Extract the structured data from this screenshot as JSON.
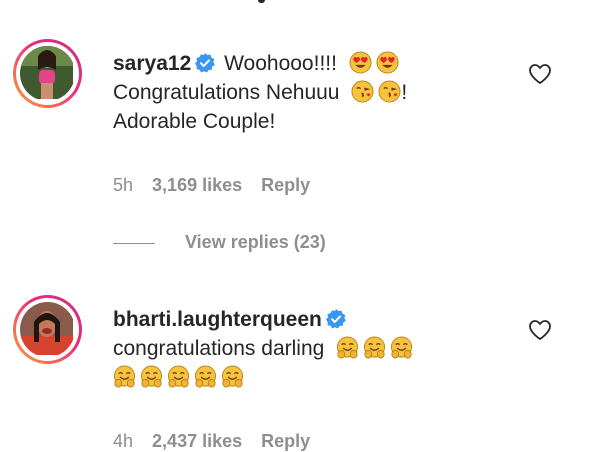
{
  "comments": [
    {
      "username": "sarya12",
      "verified": true,
      "text_line1": "Woohooo!!!!",
      "emojis_line1": [
        "heart-eyes",
        "heart-eyes"
      ],
      "text_line2": "Congratulations Nehuuu",
      "emojis_line2": [
        "kiss-face",
        "kiss-face"
      ],
      "text_line2_suffix": "!",
      "text_line3": "Adorable Couple!",
      "time": "5h",
      "likes": "3,169 likes",
      "reply_label": "Reply",
      "view_replies": "View replies (23)"
    },
    {
      "username": "bharti.laughterqueen",
      "verified": true,
      "text_line1": "congratulations darling",
      "emojis_line1": [
        "hug-face",
        "hug-face",
        "hug-face"
      ],
      "emojis_line2": [
        "hug-face",
        "hug-face",
        "hug-face",
        "hug-face",
        "hug-face"
      ],
      "time": "4h",
      "likes": "2,437 likes",
      "reply_label": "Reply"
    }
  ],
  "colors": {
    "text": "#262626",
    "secondary": "#8e8e8e",
    "verified_blue": "#3897f0",
    "emoji_yellow": "#f7c23c"
  }
}
